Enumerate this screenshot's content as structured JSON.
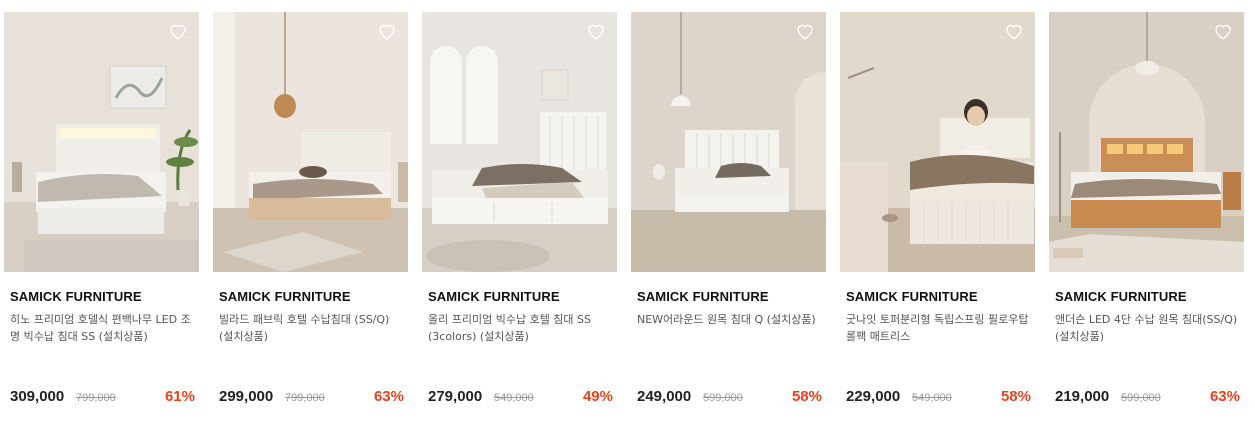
{
  "products": [
    {
      "brand": "SAMICK FURNITURE",
      "title": "히노 프리미엄 호델식 편백나무 LED 조명 빅수납 침대 SS (설치상품)",
      "price": "309,000",
      "original_price": "799,000",
      "discount": "61%"
    },
    {
      "brand": "SAMICK FURNITURE",
      "title": "빌라드 패브릭 호텔 수납침대 (SS/Q) (설치상품)",
      "price": "299,000",
      "original_price": "799,000",
      "discount": "63%"
    },
    {
      "brand": "SAMICK FURNITURE",
      "title": "올리 프리미엄 빅수납 호텔 침대 SS (3colors) (설치상품)",
      "price": "279,000",
      "original_price": "549,000",
      "discount": "49%"
    },
    {
      "brand": "SAMICK FURNITURE",
      "title": "NEW어라운드 원목 침대 Q (설치상품)",
      "price": "249,000",
      "original_price": "599,000",
      "discount": "58%"
    },
    {
      "brand": "SAMICK FURNITURE",
      "title": "굿나잇 토퍼분리형 독립스프링 필로우탑 롤팩 매트리스",
      "price": "229,000",
      "original_price": "549,000",
      "discount": "58%"
    },
    {
      "brand": "SAMICK FURNITURE",
      "title": "앤더슨 LED 4단 수납 원목 침대(SS/Q) (설치상품)",
      "price": "219,000",
      "original_price": "599,000",
      "discount": "63%"
    }
  ],
  "icons": {
    "wishlist": "heart-outline-icon"
  },
  "colors": {
    "discount": "#e8421f",
    "price": "#222222",
    "original_price": "#999999"
  }
}
